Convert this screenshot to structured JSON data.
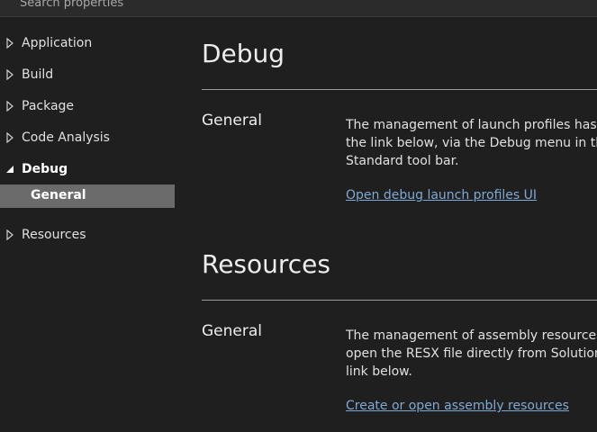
{
  "search": {
    "placeholder": "Search properties"
  },
  "sidebar": {
    "items": [
      {
        "label": "Application",
        "expanded": false
      },
      {
        "label": "Build",
        "expanded": false
      },
      {
        "label": "Package",
        "expanded": false
      },
      {
        "label": "Code Analysis",
        "expanded": false
      },
      {
        "label": "Debug",
        "expanded": true,
        "children": [
          {
            "label": "General",
            "selected": true
          }
        ]
      },
      {
        "label": "Resources",
        "expanded": false
      }
    ]
  },
  "main": {
    "sections": [
      {
        "title": "Debug",
        "subsection": "General",
        "description_lines": [
          "The management of launch profiles has m",
          "the link below, via the Debug menu in the",
          "Standard tool bar."
        ],
        "link": "Open debug launch profiles UI"
      },
      {
        "title": "Resources",
        "subsection": "General",
        "description_lines": [
          "The management of assembly resources n",
          "open the RESX file directly from Solution E",
          "link below."
        ],
        "link": "Create or open assembly resources"
      }
    ]
  },
  "colors": {
    "background": "#1f1f1f",
    "selected_item": "#6b6b6b",
    "link": "#7fa9d6",
    "divider": "#9a9a9a"
  }
}
